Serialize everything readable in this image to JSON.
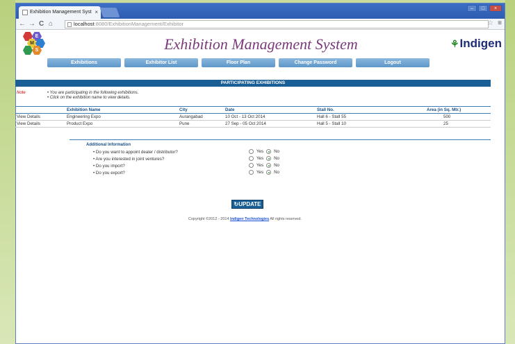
{
  "browser": {
    "tab_title": "Exhibition Management Syst",
    "tab_close": "×",
    "back": "←",
    "forward": "→",
    "reload": "C",
    "home": "⌂",
    "url_host": "localhost",
    "url_rest": ":8080/ExhibitionManagement/Exhibitor",
    "star": "☆",
    "menu": "≡",
    "win_min": "–",
    "win_max": "□",
    "win_close": "×"
  },
  "header": {
    "logo_letters": [
      "E",
      "M",
      "S"
    ],
    "title": "Exhibition Management System",
    "brand": "Indigen"
  },
  "menu": [
    "Exhibitions",
    "Exhibitor List",
    "Floor Plan",
    "Change Password",
    "Logout"
  ],
  "section_title": "PARTICIPATING EXHIBITIONS",
  "note": {
    "label": "Note",
    "lines": [
      "You are participating in the following exhibitions.",
      "Click on the exhibition name to view details."
    ]
  },
  "table": {
    "headers": [
      "",
      "Exhibition Name",
      "City",
      "Date",
      "Stall No.",
      "Area (in Sq. Mtr.)"
    ],
    "rows": [
      [
        "View Details",
        "Engineering Expo",
        "Aurangabad",
        "10 Oct - 13 Oct 2014",
        "Hall 6 - Stall 55",
        "500"
      ],
      [
        "View Details",
        "Product Expo",
        "Pune",
        "27 Sep - 05 Oct 2014",
        "Hall 5 - Stall 10",
        "25"
      ]
    ]
  },
  "additional": {
    "title": "Additional Information",
    "yes": "Yes",
    "no": "No",
    "questions": [
      "Do you want to appoint dealer / distributor?",
      "Are you interested in joint ventures?",
      "Do you import?",
      "Do you export?"
    ]
  },
  "update_label": "UPDATE",
  "footer": {
    "prefix": "Copyright ©2012 - 2014 ",
    "company": "Indigen Technologies",
    "suffix": " All rights reserved."
  },
  "colors": {
    "accent": "#1a5e96",
    "title": "#7a3a7a",
    "menu": "#6fa4d3"
  }
}
